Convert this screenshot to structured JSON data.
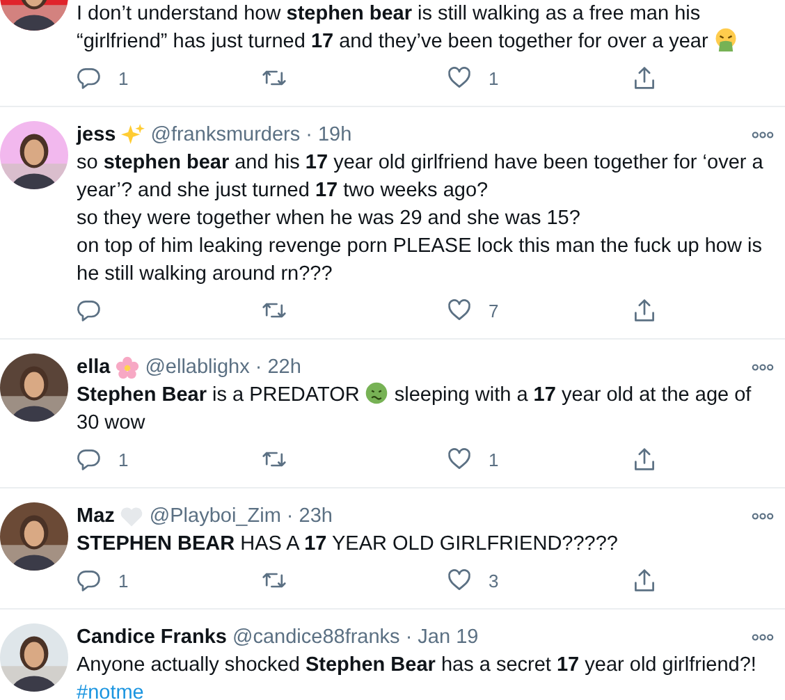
{
  "tweets": [
    {
      "cut_top": true,
      "body": [
        {
          "kind": "text",
          "text": "I don’t understand how **stephen bear** is still walking as a free man his “girlfriend” has just turned **17** and they’ve been together for over a year"
        },
        {
          "kind": "vomiting"
        }
      ],
      "replies": "1",
      "likes": "1"
    },
    {
      "name": "jess",
      "badges": [
        {
          "kind": "sparkles"
        }
      ],
      "handle": "@franksmurders",
      "time": "· 19h",
      "body": [
        {
          "kind": "text",
          "text": "so **stephen bear** and his **17** year old girlfriend have been together for ‘over a year’? and she just turned **17** two weeks ago?\nso they were together when he was 29 and she was 15?\non top of him leaking revenge porn PLEASE lock this man the fuck up how is he still walking around rn???"
        }
      ],
      "likes": "7"
    },
    {
      "name": "ella",
      "badges": [
        {
          "kind": "blossom"
        }
      ],
      "handle": "@ellablighx",
      "time": "· 22h",
      "body": [
        {
          "kind": "text",
          "text": "**Stephen Bear** is a PREDATOR"
        },
        {
          "kind": "nauseated"
        },
        {
          "kind": "text",
          "text": "sleeping with a **17** year old at the age of"
        },
        {
          "kind": "text",
          "new_line": true,
          "text": "30 wow"
        }
      ],
      "replies": "1",
      "likes": "1"
    },
    {
      "name": "Maz",
      "badges": [
        {
          "kind": "white-heart"
        }
      ],
      "handle": "@Playboi_Zim",
      "time": "· 23h",
      "body": [
        {
          "kind": "text",
          "text": "**STEPHEN BEAR** HAS A **17** YEAR OLD GIRLFRIEND?????"
        }
      ],
      "replies": "1",
      "likes": "3"
    },
    {
      "name": "Candice Franks",
      "handle": "@candice88franks",
      "time": "· Jan 19",
      "body": [
        {
          "kind": "text",
          "text": "Anyone actually shocked **Stephen Bear** has a secret **17** year old girlfriend?!"
        }
      ],
      "hashtag": "#notme",
      "no_actions": true
    }
  ]
}
